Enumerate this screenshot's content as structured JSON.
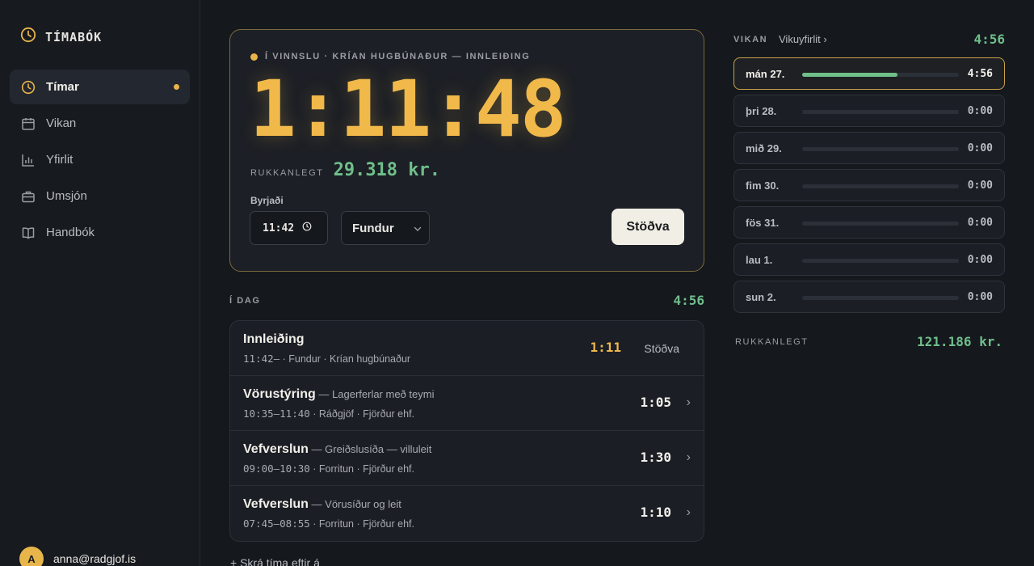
{
  "brand": {
    "name": "TÍMABÓK",
    "accent": "#e8b54a"
  },
  "nav": [
    {
      "label": "Tímar",
      "icon": "clock-icon",
      "active": true
    },
    {
      "label": "Vikan",
      "icon": "calendar-icon"
    },
    {
      "label": "Yfirlit",
      "icon": "bar-chart-icon"
    },
    {
      "label": "Umsjón",
      "icon": "briefcase-icon"
    },
    {
      "label": "Handbók",
      "icon": "book-icon"
    }
  ],
  "user": {
    "initial": "A",
    "email": "anna@radgjof.is"
  },
  "timer": {
    "status": "Í VINNSLU · KRÍAN HUGBÚNAÐUR — INNLEIÐING",
    "elapsed": "1:11:48",
    "billable_label": "RUKKANLEGT",
    "billable_value": "29.318 kr.",
    "started_label": "Byrjaði",
    "started_value": "11:42",
    "category": "Fundur",
    "stop_label": "Stöðva"
  },
  "today": {
    "label": "Í DAG",
    "total": "4:56",
    "entries": [
      {
        "title": "Innleiðing",
        "subtitle": "",
        "time": "11:42–",
        "meta": " · Fundur · Krían hugbúnaður",
        "duration": "1:11",
        "action": "Stöðva"
      },
      {
        "title": "Vörustýring",
        "subtitle": " — Lagerferlar með teymi",
        "time": "10:35–11:40",
        "meta": " · Ráðgjöf · Fjörður ehf.",
        "duration": "1:05"
      },
      {
        "title": "Vefverslun",
        "subtitle": " — Greiðslusíða — villuleit",
        "time": "09:00–10:30",
        "meta": " · Forritun · Fjörður ehf.",
        "duration": "1:30"
      },
      {
        "title": "Vefverslun",
        "subtitle": " — Vörusíður og leit",
        "time": "07:45–08:55",
        "meta": " · Forritun · Fjörður ehf.",
        "duration": "1:10"
      }
    ],
    "add_link": "+ Skrá tíma eftir á"
  },
  "week": {
    "label": "VIKAN",
    "link": "Vikuyfirlit ›",
    "total": "4:56",
    "days": [
      {
        "name": "mán 27.",
        "value": "4:56",
        "fraction": 0.61,
        "current": true
      },
      {
        "name": "þri 28.",
        "value": "0:00",
        "fraction": 0
      },
      {
        "name": "mið 29.",
        "value": "0:00",
        "fraction": 0
      },
      {
        "name": "fim 30.",
        "value": "0:00",
        "fraction": 0
      },
      {
        "name": "fös 31.",
        "value": "0:00",
        "fraction": 0
      },
      {
        "name": "lau 1.",
        "value": "0:00",
        "fraction": 0
      },
      {
        "name": "sun 2.",
        "value": "0:00",
        "fraction": 0
      }
    ],
    "billable_label": "RUKKANLEGT",
    "billable_value": "121.186 kr."
  },
  "colors": {
    "billable_green": "#6fbf8b",
    "timer_amber": "#f0b94a"
  }
}
